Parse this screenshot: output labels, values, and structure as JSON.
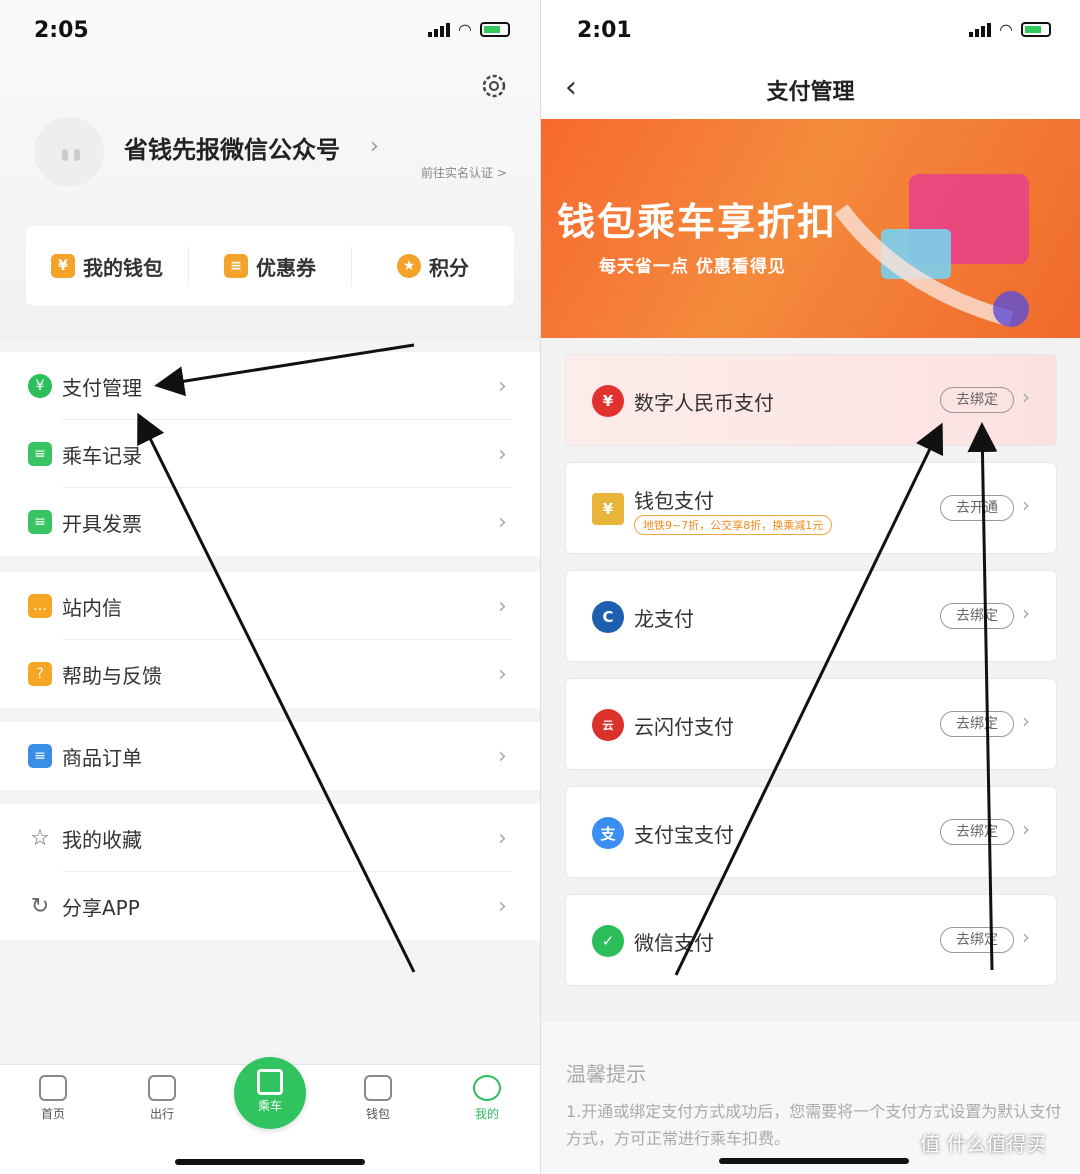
{
  "left": {
    "status_time": "2:05",
    "user": {
      "name": "省钱先报微信公众号",
      "verify_link": "前往实名认证 >"
    },
    "quick_actions": [
      {
        "label": "我的钱包",
        "icon": "wallet-icon"
      },
      {
        "label": "优惠券",
        "icon": "coupon-icon"
      },
      {
        "label": "积分",
        "icon": "points-icon"
      }
    ],
    "menu": [
      {
        "label": "支付管理",
        "icon": "yuan-icon"
      },
      {
        "label": "乘车记录",
        "icon": "record-icon"
      },
      {
        "label": "开具发票",
        "icon": "invoice-icon"
      },
      {
        "label": "站内信",
        "icon": "message-icon"
      },
      {
        "label": "帮助与反馈",
        "icon": "help-icon"
      },
      {
        "label": "商品订单",
        "icon": "order-icon"
      },
      {
        "label": "我的收藏",
        "icon": "star-icon"
      },
      {
        "label": "分享APP",
        "icon": "share-icon"
      }
    ],
    "tabs": [
      {
        "label": "首页"
      },
      {
        "label": "出行"
      },
      {
        "label": "乘车"
      },
      {
        "label": "钱包"
      },
      {
        "label": "我的"
      }
    ]
  },
  "right": {
    "status_time": "2:01",
    "title": "支付管理",
    "banner": {
      "title": "钱包乘车享折扣",
      "subtitle": "每天省一点  优惠看得见"
    },
    "methods": [
      {
        "name": "数字人民币支付",
        "action": "去绑定",
        "color": "#e0322f",
        "glyph": "¥"
      },
      {
        "name": "钱包支付",
        "sub": "地铁9~7折，公交享8折，换乘减1元",
        "action": "去开通",
        "color": "#e8b43a",
        "glyph": "¥"
      },
      {
        "name": "龙支付",
        "action": "去绑定",
        "color": "#1f5fb0",
        "glyph": "C"
      },
      {
        "name": "云闪付支付",
        "action": "去绑定",
        "color": "#d9332b",
        "glyph": "云"
      },
      {
        "name": "支付宝支付",
        "action": "去绑定",
        "color": "#3b8ff0",
        "glyph": "支"
      },
      {
        "name": "微信支付",
        "action": "去绑定",
        "color": "#2bbe5b",
        "glyph": "✓"
      }
    ],
    "tips": {
      "title": "温馨提示",
      "text": "1.开通或绑定支付方式成功后，您需要将一个支付方式设置为默认支付方式，方可正常进行乘车扣费。"
    }
  },
  "watermark": "值 什么值得买"
}
